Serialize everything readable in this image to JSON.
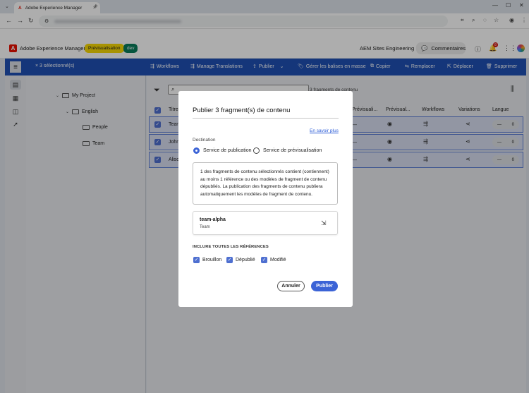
{
  "browser": {
    "tab_title": "Adobe Experience Manager",
    "tab_close": "×",
    "new_tab": "+"
  },
  "header": {
    "product": "Adobe Experience Manager",
    "badge_preview": "Prévisualisation",
    "badge_env": "dev",
    "org": "AEM Sites Engineering",
    "comments": "Commentaires",
    "notif_count": "8"
  },
  "actionbar": {
    "selection": "3 sélectionné(s)",
    "actions": [
      {
        "label": "Workflows",
        "icon": "workflow-icon"
      },
      {
        "label": "Manage Translations",
        "icon": "translate-icon"
      },
      {
        "label": "Publier",
        "icon": "publish-icon"
      },
      {
        "label": "Gérer les balises en masse",
        "icon": "tag-icon"
      },
      {
        "label": "Copier",
        "icon": "copy-icon"
      },
      {
        "label": "Remplacer",
        "icon": "replace-icon"
      },
      {
        "label": "Déplacer",
        "icon": "move-icon"
      },
      {
        "label": "Supprimer",
        "icon": "delete-icon"
      }
    ]
  },
  "tree": {
    "items": [
      {
        "label": "My Project"
      },
      {
        "label": "English"
      },
      {
        "label": "People"
      },
      {
        "label": "Team"
      }
    ]
  },
  "main": {
    "count": "3 fragments de contenu",
    "columns": [
      "Titre",
      "Prévisuali...",
      "Prévisual...",
      "Workflows",
      "Variations",
      "Langue"
    ],
    "rows": [
      {
        "name": "Tean",
        "lang": "0",
        "dash": "—"
      },
      {
        "name": "John",
        "lang": "0",
        "dash": "—"
      },
      {
        "name": "Alisc",
        "lang": "0",
        "dash": "—"
      }
    ]
  },
  "dialog": {
    "title": "Publier 3 fragment(s) de contenu",
    "learn_more": "En savoir plus",
    "destination_label": "Destination",
    "radio_publish": "Service de publication",
    "radio_preview": "Service de prévisualisation",
    "info": "1 des fragments de contenu sélectionnés contient (contiennent) au moins 1 référence ou des modèles de fragment de contenu dépubliés. La publication des fragments de contenu publiera automatiquement les modèles de fragment de contenu.",
    "card_title": "team-alpha",
    "card_subtitle": "Team",
    "include_label": "INCLURE TOUTES LES RÉFÉRENCES",
    "chk_draft": "Brouillon",
    "chk_unpublished": "Dépublié",
    "chk_modified": "Modifié",
    "cancel": "Annuler",
    "publish": "Publier"
  }
}
